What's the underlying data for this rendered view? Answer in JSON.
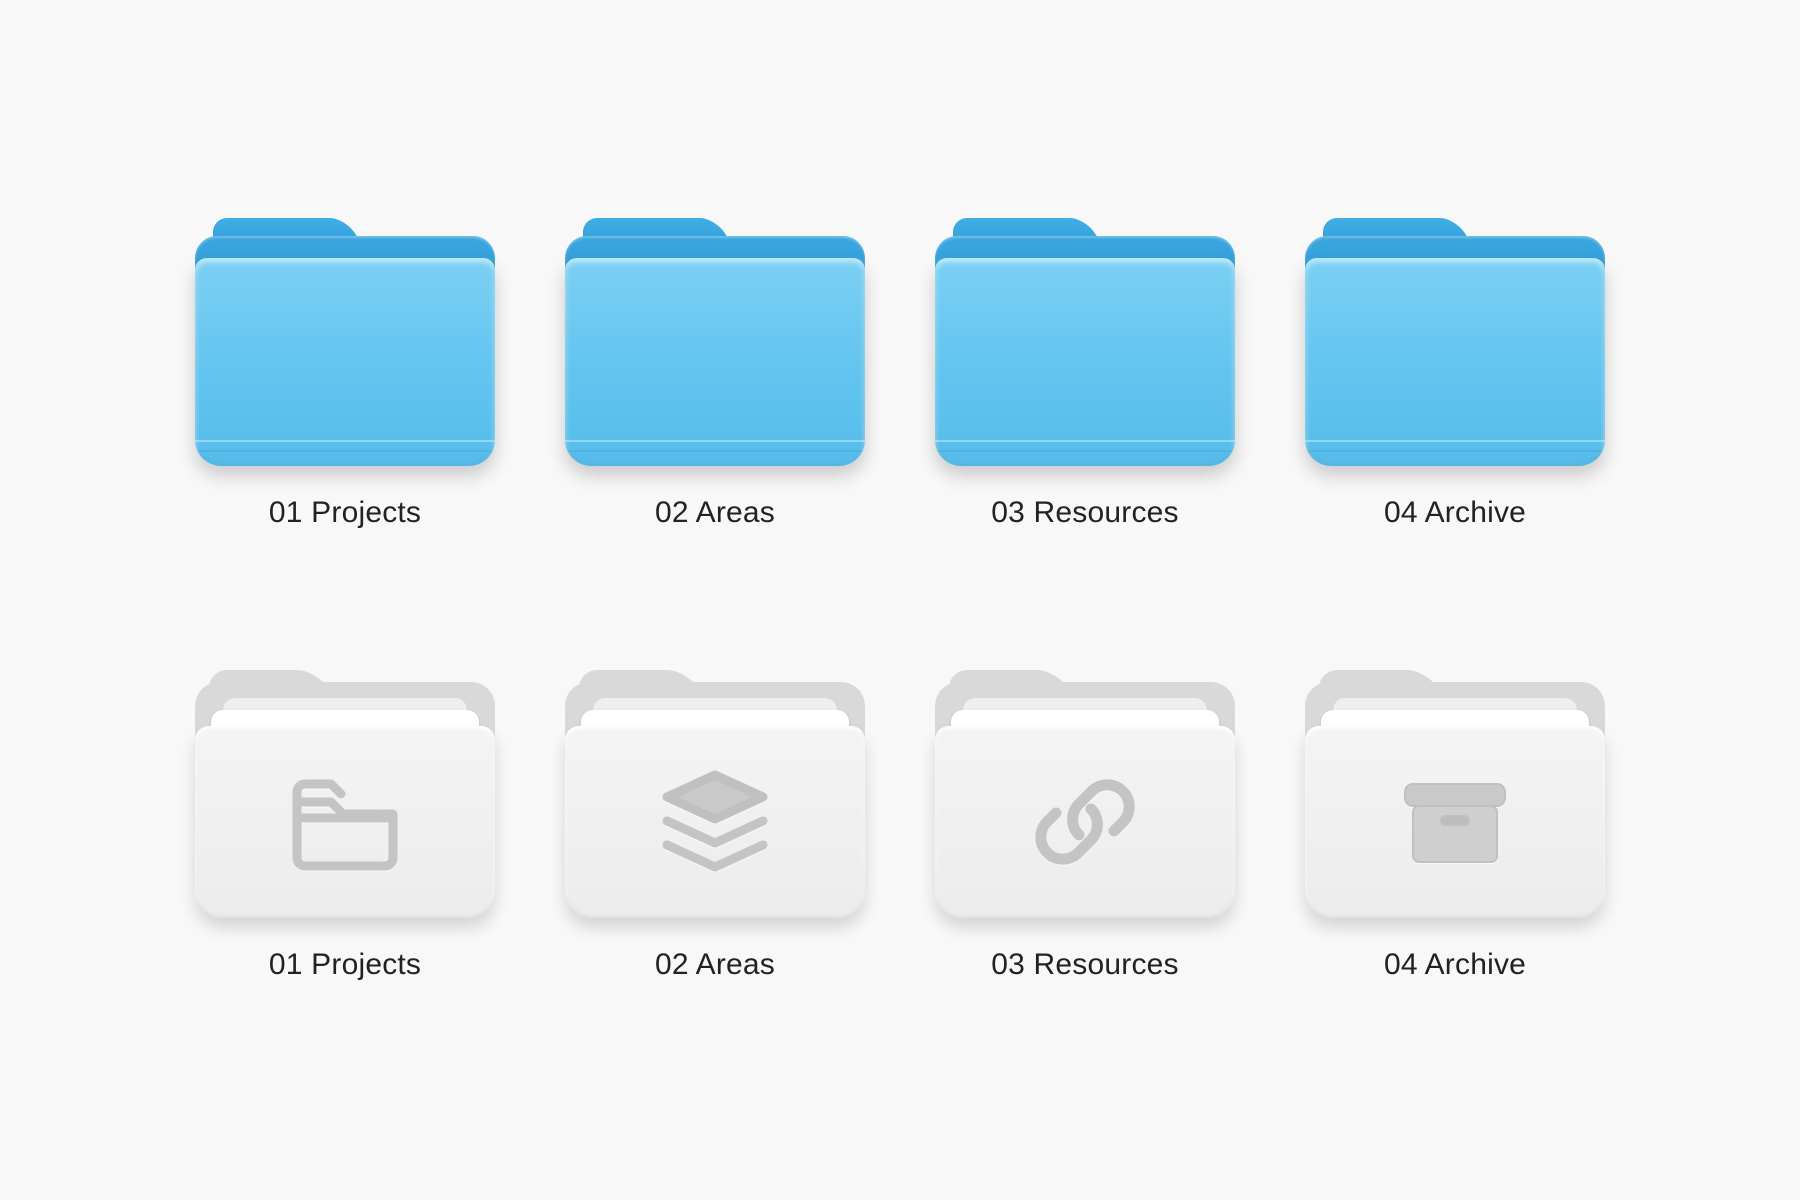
{
  "rows": [
    {
      "style": "blue",
      "folders": [
        {
          "label": "01 Projects",
          "icon": "folder-icon"
        },
        {
          "label": "02 Areas",
          "icon": "folder-icon"
        },
        {
          "label": "03 Resources",
          "icon": "folder-icon"
        },
        {
          "label": "04 Archive",
          "icon": "folder-icon"
        }
      ]
    },
    {
      "style": "light",
      "folders": [
        {
          "label": "01 Projects",
          "icon": "folder-outline-icon"
        },
        {
          "label": "02 Areas",
          "icon": "stack-icon"
        },
        {
          "label": "03 Resources",
          "icon": "link-icon"
        },
        {
          "label": "04 Archive",
          "icon": "archive-box-icon"
        }
      ]
    }
  ],
  "colors": {
    "background": "#f8f8f8",
    "folder_blue_light": "#7cd0f3",
    "folder_blue_dark": "#2f99d6",
    "folder_light_face": "#efefef",
    "folder_light_back": "#d9d9d9",
    "label_text": "#222222",
    "glyph": "#c6c6c6"
  }
}
